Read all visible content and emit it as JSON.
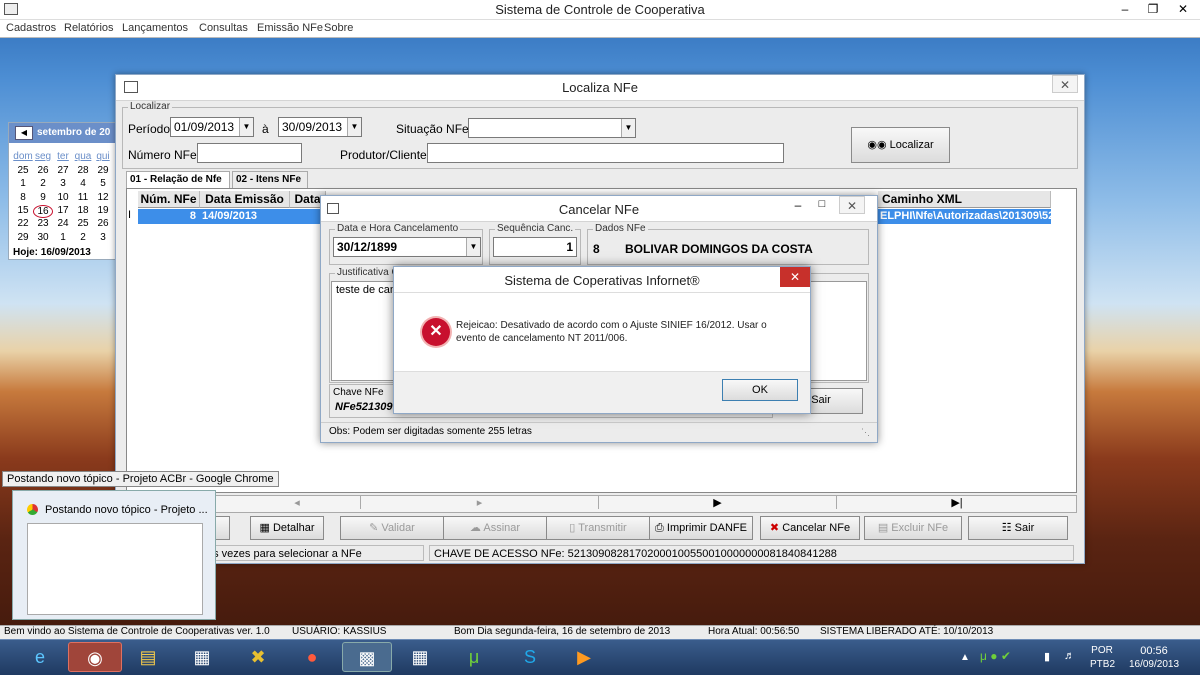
{
  "app": {
    "title": "Sistema de Controle de Cooperativa",
    "menu": [
      "Cadastros",
      "Relatórios",
      "Lançamentos",
      "Consultas",
      "Emissão NFe",
      "Sobre"
    ]
  },
  "calendar": {
    "month": "setembro de 20",
    "days_header": [
      "dom",
      "seg",
      "ter",
      "qua",
      "qui"
    ],
    "rows": [
      [
        "25",
        "26",
        "27",
        "28",
        "29"
      ],
      [
        "1",
        "2",
        "3",
        "4",
        "5"
      ],
      [
        "8",
        "9",
        "10",
        "11",
        "12"
      ],
      [
        "15",
        "16",
        "17",
        "18",
        "19"
      ],
      [
        "22",
        "23",
        "24",
        "25",
        "26"
      ],
      [
        "29",
        "30",
        "1",
        "2",
        "3"
      ]
    ],
    "today": "Hoje: 16/09/2013"
  },
  "localiza": {
    "title": "Localiza NFe",
    "group_label": "Localizar",
    "periodo_label": "Período",
    "date_from": "01/09/2013",
    "ate_label": "à",
    "date_to": "30/09/2013",
    "situacao_label": "Situação NFe",
    "situacao_value": "",
    "numero_label": "Número NFe",
    "numero_value": "",
    "produtor_label": "Produtor/Cliente",
    "produtor_value": "",
    "search_button": "Localizar",
    "tabs": [
      "01 - Relação de Nfe",
      "02 - Itens NFe"
    ],
    "columns": [
      "Núm. NFe",
      "Data Emissão",
      "Data",
      "Caminho XML"
    ],
    "row": {
      "num": "8",
      "emissao": "14/09/2013",
      "data": "",
      "caminho": "ELPHI\\Nfe\\Autorizadas\\201309\\52"
    },
    "nav": [
      "◂",
      "▸",
      "▶",
      "▶|"
    ],
    "buttons": {
      "detalhar": "Detalhar",
      "validar": "Validar",
      "assinar": "Assinar",
      "transmitir": "Transmitir",
      "imprimir": "Imprimir DANFE",
      "cancelar": "Cancelar NFe",
      "excluir": "Excluir NFe",
      "sair": "Sair"
    },
    "footer_hint": "os vezes para selecionar a NFe",
    "chave": "CHAVE DE ACESSO NFe: 52130908281702000100550010000000081840841288"
  },
  "cancel": {
    "title": "Cancelar NFe",
    "data_label": "Data e Hora Cancelamento",
    "data_value": "30/12/1899",
    "seq_label": "Sequência Canc.",
    "seq_value": "1",
    "dados_label": "Dados NFe",
    "dados_num": "8",
    "dados_nome": "BOLIVAR DOMINGOS DA COSTA",
    "just_label": "Justificativa C",
    "just_value": "teste de canc",
    "chave_label": "Chave NFe",
    "chave_value": "NFe521309",
    "sair": "Sair",
    "obs": "Obs: Podem ser digitadas somente 255 letras"
  },
  "error": {
    "title": "Sistema de Coperativas Infornet®",
    "message": "Rejeicao: Desativado de acordo com o Ajuste SINIEF 16/2012. Usar o evento de cancelamento NT 2011/006.",
    "ok": "OK"
  },
  "tooltip": {
    "text": "Postando novo tópico - Projeto ACBr - Google Chrome",
    "preview_title": "Postando novo tópico - Projeto ..."
  },
  "status": {
    "bem_vindo": "Bem vindo ao Sistema de Controle de Cooperativas ver. 1.0",
    "usuario": "USUÁRIO: KASSIUS",
    "bom_dia": "Bom Dia  segunda-feira, 16 de setembro de 2013",
    "hora": "Hora Atual: 00:56:50",
    "liberado": "SISTEMA LIBERADO ATÉ: 10/10/2013"
  },
  "tray": {
    "lang": "POR",
    "layout": "PTB2",
    "time": "00:56",
    "date": "16/09/2013"
  },
  "colors": {
    "selection": "#3d8ee9",
    "error_red": "#c8102e",
    "close_red": "#c7302b"
  }
}
